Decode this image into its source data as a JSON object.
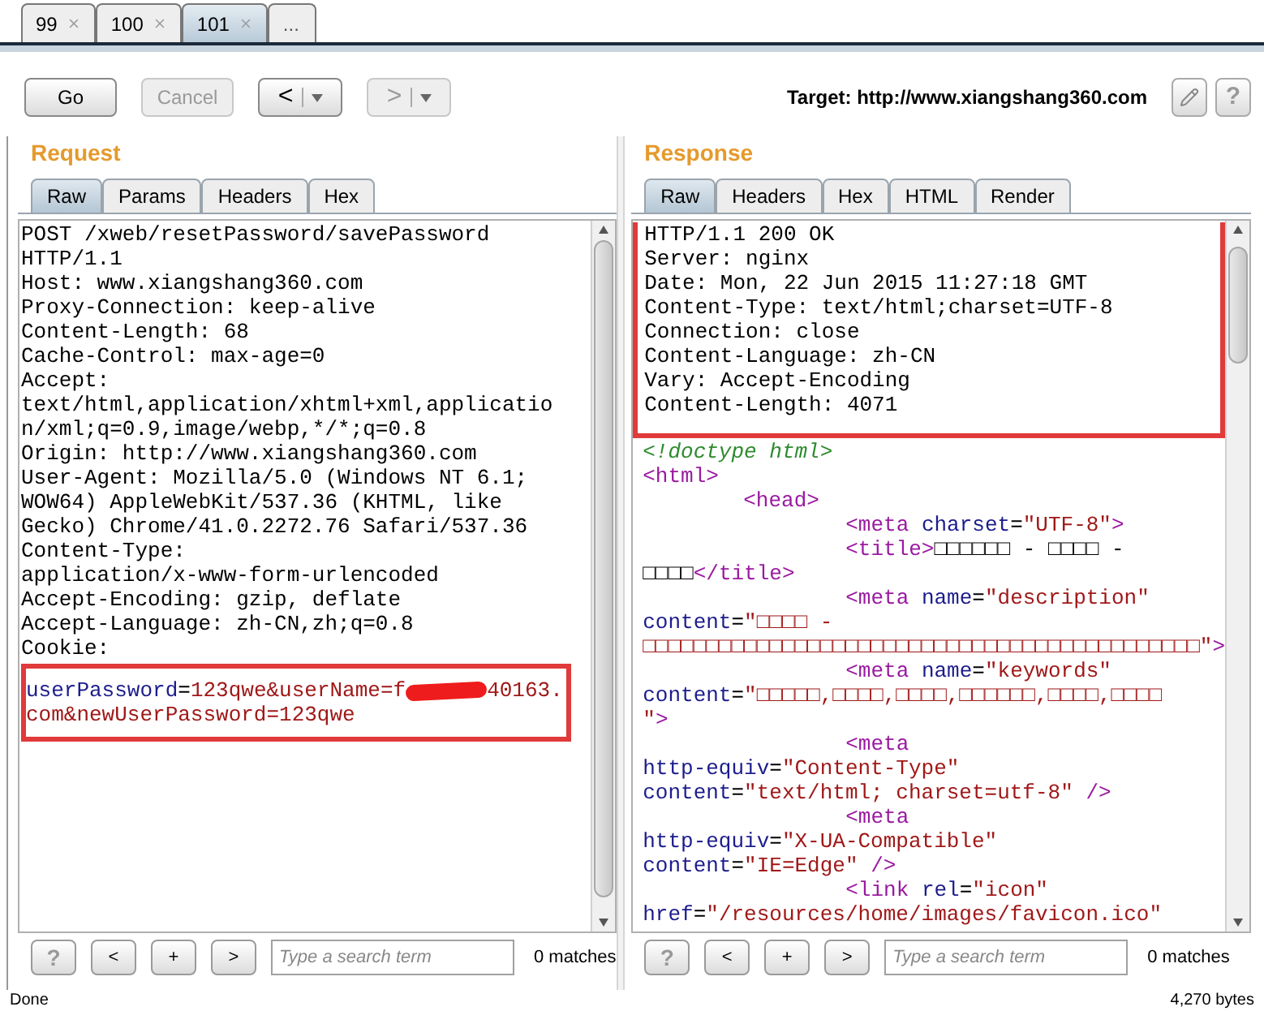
{
  "request_tabs": [
    {
      "label": "99",
      "selected": false,
      "closable": true
    },
    {
      "label": "100",
      "selected": false,
      "closable": true
    },
    {
      "label": "101",
      "selected": true,
      "closable": true
    },
    {
      "label": "...",
      "selected": false,
      "closable": false
    }
  ],
  "toolbar": {
    "go": {
      "label": "Go",
      "disabled": false
    },
    "cancel": {
      "label": "Cancel",
      "disabled": true
    },
    "history": [
      {
        "label": "<",
        "disabled": false
      },
      {
        "label": ">",
        "disabled": true
      }
    ],
    "target": "Target: http://www.xiangshang360.com",
    "help": "?"
  },
  "request": {
    "title": "Request",
    "tabs": [
      {
        "label": "Raw",
        "selected": true
      },
      {
        "label": "Params",
        "selected": false
      },
      {
        "label": "Headers",
        "selected": false
      },
      {
        "label": "Hex",
        "selected": false
      }
    ],
    "lines": [
      "POST /xweb/resetPassword/savePassword",
      "HTTP/1.1",
      "Host: www.xiangshang360.com",
      "Proxy-Connection: keep-alive",
      "Content-Length: 68",
      "Cache-Control: max-age=0",
      "Accept:",
      "text/html,application/xhtml+xml,applicatio",
      "n/xml;q=0.9,image/webp,*/*;q=0.8",
      "Origin: http://www.xiangshang360.com",
      "User-Agent: Mozilla/5.0 (Windows NT 6.1;",
      "WOW64) AppleWebKit/537.36 (KHTML, like",
      "Gecko) Chrome/41.0.2272.76 Safari/537.36",
      "Content-Type:",
      "application/x-www-form-urlencoded",
      "Accept-Encoding: gzip, deflate",
      "Accept-Language: zh-CN,zh;q=0.8",
      "Cookie:"
    ],
    "body_highlighted": true,
    "body": [
      [
        {
          "kind": "attr",
          "text": "userPassword"
        },
        {
          "kind": "text",
          "text": "="
        },
        {
          "kind": "value",
          "text": "123qwe&userName=f"
        },
        {
          "kind": "redaction"
        },
        {
          "kind": "value",
          "text": "40163."
        }
      ],
      [
        {
          "kind": "value",
          "text": "com&newUserPassword=123qwe"
        }
      ]
    ],
    "search": {
      "help": "?",
      "prev": "<",
      "add": "+",
      "next": ">",
      "placeholder": "Type a search term",
      "matches": "0 matches"
    }
  },
  "response": {
    "title": "Response",
    "tabs": [
      {
        "label": "Raw",
        "selected": true
      },
      {
        "label": "Headers",
        "selected": false
      },
      {
        "label": "Hex",
        "selected": false
      },
      {
        "label": "HTML",
        "selected": false
      },
      {
        "label": "Render",
        "selected": false
      }
    ],
    "headers_highlighted": true,
    "headers": [
      "HTTP/1.1 200 OK",
      "Server: nginx",
      "Date: Mon, 22 Jun 2015 11:27:18 GMT",
      "Content-Type: text/html;charset=UTF-8",
      "Connection: close",
      "Content-Language: zh-CN",
      "Vary: Accept-Encoding",
      "Content-Length: 4071"
    ],
    "body": [
      {
        "kind": "flush",
        "tokens": [
          {
            "kind": "comment",
            "text": "<!doctype html>"
          }
        ]
      },
      {
        "kind": "flush",
        "tokens": [
          {
            "kind": "tag",
            "text": "<html>"
          }
        ]
      },
      {
        "kind": "indent1",
        "tokens": [
          {
            "kind": "tag",
            "text": "<head>"
          }
        ]
      },
      {
        "kind": "indent2",
        "tokens": [
          {
            "kind": "tag",
            "text": "<meta"
          },
          {
            "kind": "attr",
            "text": " charset"
          },
          {
            "kind": "text",
            "text": "="
          },
          {
            "kind": "value",
            "text": "\"UTF-8\""
          },
          {
            "kind": "tag",
            "text": ">"
          }
        ]
      },
      {
        "kind": "indent2",
        "tokens": [
          {
            "kind": "tag",
            "text": "<title>"
          },
          {
            "kind": "text",
            "text": "□□□□□□ - □□□□ -"
          }
        ]
      },
      {
        "kind": "flush",
        "tokens": [
          {
            "kind": "text",
            "text": "□□□□"
          },
          {
            "kind": "tag",
            "text": "</title>"
          }
        ]
      },
      {
        "kind": "indent2",
        "tokens": [
          {
            "kind": "tag",
            "text": "<meta"
          },
          {
            "kind": "attr",
            "text": " name"
          },
          {
            "kind": "text",
            "text": "="
          },
          {
            "kind": "value",
            "text": "\"description\""
          }
        ]
      },
      {
        "kind": "flush",
        "tokens": [
          {
            "kind": "attr",
            "text": "content"
          },
          {
            "kind": "text",
            "text": "="
          },
          {
            "kind": "value",
            "text": "\"□□□□ -"
          }
        ]
      },
      {
        "kind": "flush",
        "tokens": [
          {
            "kind": "value",
            "text": "□□□□□□□□□□□□□□□□□□□□□□□□□□□□□□□□□□□□□□□□□□□□\""
          },
          {
            "kind": "tag",
            "text": ">"
          }
        ]
      },
      {
        "kind": "indent2",
        "tokens": [
          {
            "kind": "tag",
            "text": "<meta"
          },
          {
            "kind": "attr",
            "text": " name"
          },
          {
            "kind": "text",
            "text": "="
          },
          {
            "kind": "value",
            "text": "\"keywords\""
          }
        ]
      },
      {
        "kind": "flush",
        "tokens": [
          {
            "kind": "attr",
            "text": "content"
          },
          {
            "kind": "text",
            "text": "="
          },
          {
            "kind": "value",
            "text": "\"□□□□□,□□□□,□□□□,□□□□□□,□□□□,□□□□"
          }
        ]
      },
      {
        "kind": "flush",
        "tokens": [
          {
            "kind": "value",
            "text": "\""
          },
          {
            "kind": "tag",
            "text": ">"
          }
        ]
      },
      {
        "kind": "indent2",
        "tokens": [
          {
            "kind": "tag",
            "text": "<meta"
          }
        ]
      },
      {
        "kind": "flush",
        "tokens": [
          {
            "kind": "attr",
            "text": "http-equiv"
          },
          {
            "kind": "text",
            "text": "="
          },
          {
            "kind": "value",
            "text": "\"Content-Type\""
          }
        ]
      },
      {
        "kind": "flush",
        "tokens": [
          {
            "kind": "attr",
            "text": "content"
          },
          {
            "kind": "text",
            "text": "="
          },
          {
            "kind": "value",
            "text": "\"text/html; charset=utf-8\""
          },
          {
            "kind": "tag",
            "text": " />"
          }
        ]
      },
      {
        "kind": "indent2",
        "tokens": [
          {
            "kind": "tag",
            "text": "<meta"
          }
        ]
      },
      {
        "kind": "flush",
        "tokens": [
          {
            "kind": "attr",
            "text": "http-equiv"
          },
          {
            "kind": "text",
            "text": "="
          },
          {
            "kind": "value",
            "text": "\"X-UA-Compatible\""
          }
        ]
      },
      {
        "kind": "flush",
        "tokens": [
          {
            "kind": "attr",
            "text": "content"
          },
          {
            "kind": "text",
            "text": "="
          },
          {
            "kind": "value",
            "text": "\"IE=Edge\""
          },
          {
            "kind": "tag",
            "text": " />"
          }
        ]
      },
      {
        "kind": "indent2",
        "tokens": [
          {
            "kind": "tag",
            "text": "<link"
          },
          {
            "kind": "attr",
            "text": " rel"
          },
          {
            "kind": "text",
            "text": "="
          },
          {
            "kind": "value",
            "text": "\"icon\""
          }
        ]
      },
      {
        "kind": "flush",
        "tokens": [
          {
            "kind": "attr",
            "text": "href"
          },
          {
            "kind": "text",
            "text": "="
          },
          {
            "kind": "value",
            "text": "\"/resources/home/images/favicon.ico\""
          }
        ]
      }
    ],
    "search": {
      "help": "?",
      "prev": "<",
      "add": "+",
      "next": ">",
      "placeholder": "Type a search term",
      "matches": "0 matches"
    }
  },
  "status_bar": {
    "left": "Done",
    "right": "4,270 bytes"
  }
}
